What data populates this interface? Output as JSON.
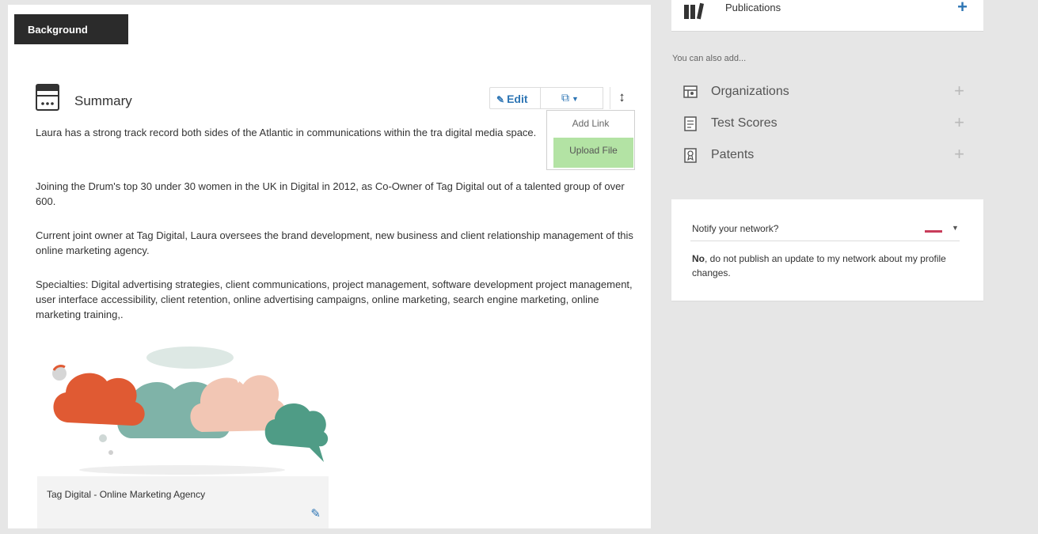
{
  "colors": {
    "accent": "#2d75b4",
    "tab_bg": "#2b2b2b",
    "upload_highlight": "#b3e3a4",
    "notify_dash": "#c83c5a",
    "cloud_orange": "#e05a33",
    "cloud_teal": "#7fb3a8",
    "cloud_peach": "#f2c6b4",
    "cloud_green": "#4f9c86"
  },
  "background_tab": {
    "label": "Background"
  },
  "summary": {
    "title": "Summary",
    "icon": "summary-card-icon",
    "edit_label": "Edit",
    "media_icon": "add-media-icon",
    "reorder_icon": "reorder-icon",
    "dropdown": {
      "add_link": "Add Link",
      "upload_file": "Upload File"
    },
    "paragraphs": [
      "Laura has a strong track record both sides of the Atlantic in communications within the tra digital media space.",
      "Joining the Drum's top 30 under 30 women in the UK in Digital in 2012, as Co-Owner of Tag Digital out of a talented group of over 600.",
      "Current joint owner at Tag Digital, Laura oversees the brand development, new business and client relationship management of this online marketing agency.",
      "Specialties: Digital advertising strategies, client communications, project management, software development project management, user interface accessibility, client retention, online advertising campaigns, online marketing, search engine marketing, online marketing training,."
    ],
    "media": {
      "caption": "Tag Digital - Online Marketing Agency",
      "edit_icon": "pencil-icon"
    }
  },
  "sidebar": {
    "publications": {
      "label": "Publications",
      "icon": "publications-icon",
      "add_symbol": "+"
    },
    "also_add_label": "You can also add...",
    "items": [
      {
        "label": "Organizations",
        "icon": "organizations-icon",
        "add_symbol": "+"
      },
      {
        "label": "Test Scores",
        "icon": "test-scores-icon",
        "add_symbol": "+"
      },
      {
        "label": "Patents",
        "icon": "patents-icon",
        "add_symbol": "+"
      }
    ],
    "notify": {
      "question": "Notify your network?",
      "answer_bold": "No",
      "answer_rest": ", do not publish an update to my network about my profile changes."
    }
  }
}
